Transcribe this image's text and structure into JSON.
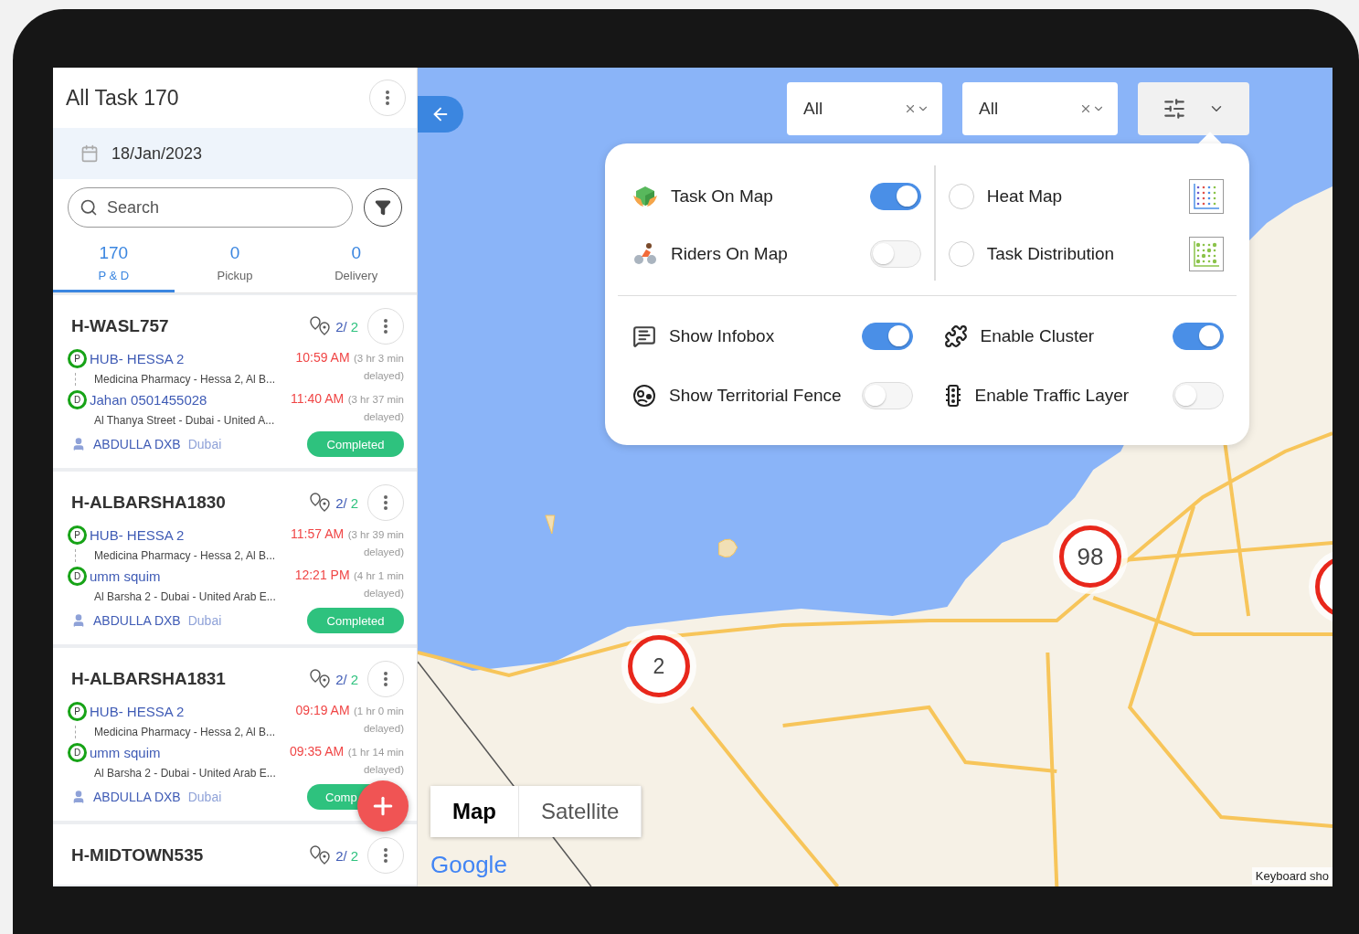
{
  "sidebar": {
    "title": "All Task 170",
    "date": "18/Jan/2023",
    "search": {
      "placeholder": "Search"
    },
    "tabs": [
      {
        "count": "170",
        "label": "P & D",
        "selected": true
      },
      {
        "count": "0",
        "label": "Pickup",
        "selected": false
      },
      {
        "count": "0",
        "label": "Delivery",
        "selected": false
      }
    ],
    "tasks": [
      {
        "id": "H-WASL757",
        "done": "2/",
        "total": "2",
        "stops": [
          {
            "marker": "P",
            "name": "HUB- HESSA 2",
            "address": "Medicina Pharmacy - Hessa 2, Al B...",
            "time": "10:59 AM",
            "delay": "(3 hr 3 min delayed)"
          },
          {
            "marker": "D",
            "name": "Jahan 0501455028",
            "address": "Al Thanya Street - Dubai - United A...",
            "time": "11:40 AM",
            "delay": "(3 hr 37 min delayed)"
          }
        ],
        "rider": "ABDULLA DXB",
        "city": "Dubai",
        "status": "Completed"
      },
      {
        "id": "H-ALBARSHA1830",
        "done": "2/",
        "total": "2",
        "stops": [
          {
            "marker": "P",
            "name": "HUB- HESSA 2",
            "address": "Medicina Pharmacy - Hessa 2, Al B...",
            "time": "11:57 AM",
            "delay": "(3 hr 39 min delayed)"
          },
          {
            "marker": "D",
            "name": "umm squim",
            "address": "Al Barsha 2 - Dubai - United Arab E...",
            "time": "12:21 PM",
            "delay": "(4 hr 1 min delayed)"
          }
        ],
        "rider": "ABDULLA DXB",
        "city": "Dubai",
        "status": "Completed"
      },
      {
        "id": "H-ALBARSHA1831",
        "done": "2/",
        "total": "2",
        "stops": [
          {
            "marker": "P",
            "name": "HUB- HESSA 2",
            "address": "Medicina Pharmacy - Hessa 2, Al B...",
            "time": "09:19 AM",
            "delay": "(1 hr 0 min delayed)"
          },
          {
            "marker": "D",
            "name": "umm squim",
            "address": "Al Barsha 2 - Dubai - United Arab E...",
            "time": "09:35 AM",
            "delay": "(1 hr 14 min delayed)"
          }
        ],
        "rider": "ABDULLA DXB",
        "city": "Dubai",
        "status": "Comp"
      },
      {
        "id": "H-MIDTOWN535",
        "done": "2/",
        "total": "2"
      }
    ]
  },
  "map": {
    "filters": [
      {
        "value": "All"
      },
      {
        "value": "All"
      }
    ],
    "layers_panel": {
      "layers": [
        {
          "label": "Task On Map",
          "on": true
        },
        {
          "label": "Riders On Map",
          "on": false
        }
      ],
      "views": [
        {
          "label": "Heat Map",
          "selected": false
        },
        {
          "label": "Task Distribution",
          "selected": false
        }
      ],
      "options": [
        {
          "label": "Show Infobox",
          "on": true
        },
        {
          "label": "Enable Cluster",
          "on": true
        },
        {
          "label": "Show Territorial Fence",
          "on": false
        },
        {
          "label": "Enable Traffic Layer",
          "on": false
        }
      ]
    },
    "clusters": [
      {
        "count": "98"
      },
      {
        "count": "2"
      }
    ],
    "map_types": [
      {
        "label": "Map",
        "selected": true
      },
      {
        "label": "Satellite",
        "selected": false
      }
    ],
    "logo": "Google",
    "attribution": "Keyboard sho"
  }
}
